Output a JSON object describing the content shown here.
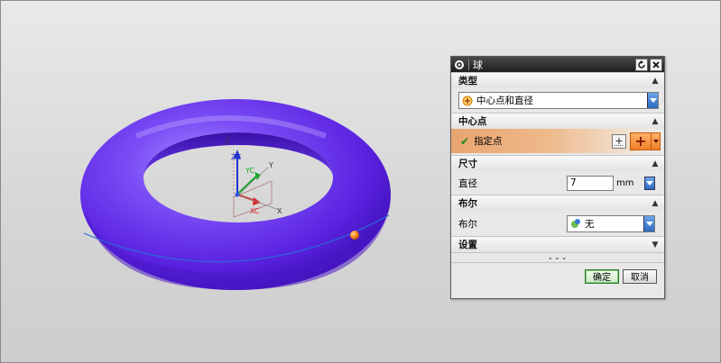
{
  "dialog": {
    "title": "球",
    "type_section": {
      "heading": "类型",
      "selected": "中心点和直径"
    },
    "center_section": {
      "heading": "中心点",
      "specify_label": "指定点"
    },
    "size_section": {
      "heading": "尺寸",
      "diameter_label": "直径",
      "diameter_value": "7",
      "unit": "mm"
    },
    "boolean_section": {
      "heading": "布尔",
      "boolean_label": "布尔",
      "boolean_value": "无"
    },
    "settings_section": {
      "heading": "设置"
    },
    "more_indicator": "⌄⌄⌄",
    "ok_label": "确定",
    "cancel_label": "取消"
  },
  "viewport": {
    "axis_labels": {
      "zc": "ZC",
      "yc": "YC",
      "xc": "XC",
      "z": "Z",
      "y": "Y",
      "x": "X"
    },
    "torus_color": "#6633ee",
    "marker_color": "#ff8a1a"
  }
}
